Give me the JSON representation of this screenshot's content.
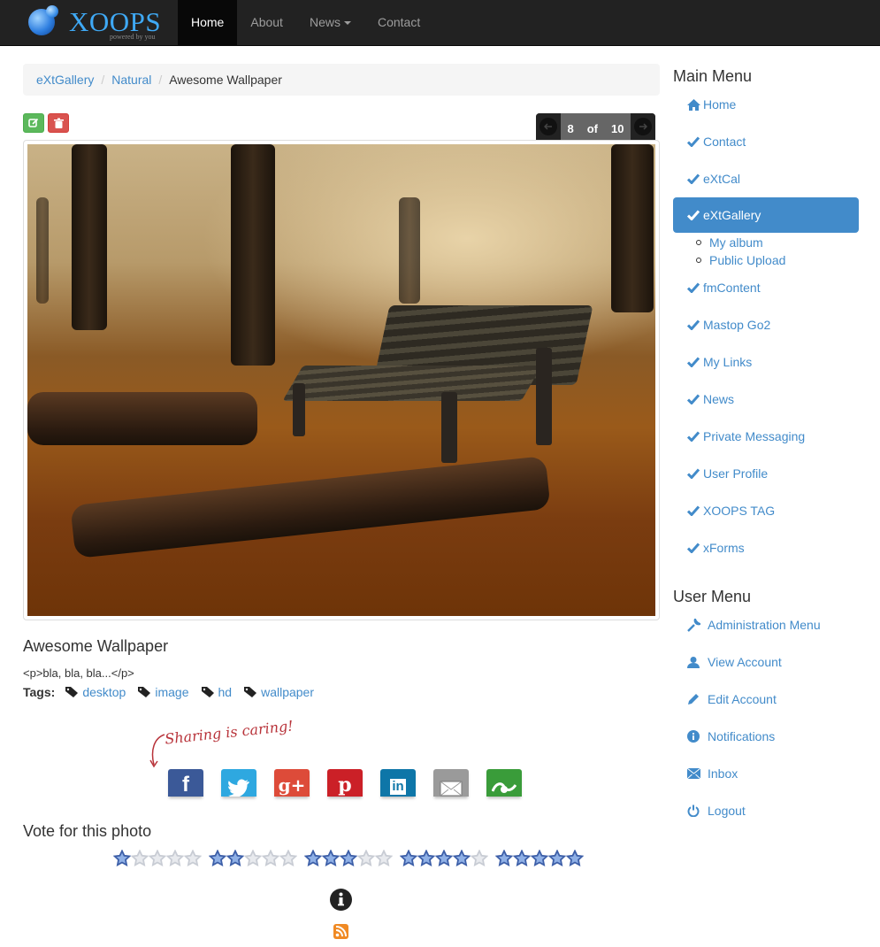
{
  "navbar": {
    "brand": "XOOPS",
    "brand_tagline": "powered by you",
    "items": [
      {
        "label": "Home",
        "active": true
      },
      {
        "label": "About",
        "active": false
      },
      {
        "label": "News",
        "active": false,
        "dropdown": true
      },
      {
        "label": "Contact",
        "active": false
      }
    ]
  },
  "breadcrumb": [
    {
      "label": "eXtGallery",
      "link": true
    },
    {
      "label": "Natural",
      "link": true
    },
    {
      "label": "Awesome Wallpaper",
      "link": false
    }
  ],
  "actions": {
    "edit_icon": "edit-icon",
    "delete_icon": "trash-icon"
  },
  "pager": {
    "current": "8",
    "of_label": "of",
    "total": "10",
    "prev_icon": "arrow-left-icon",
    "next_icon": "arrow-right-icon"
  },
  "photo": {
    "title": "Awesome Wallpaper",
    "description": "<p>bla, bla, bla...</p>",
    "alt": "Autumn park bench with fallen leaves"
  },
  "tags": {
    "label": "Tags:",
    "items": [
      "desktop",
      "image",
      "hd",
      "wallpaper"
    ]
  },
  "share": {
    "note": "Sharing is caring!",
    "buttons": [
      {
        "name": "facebook",
        "glyph": "f",
        "color": "#3b5998"
      },
      {
        "name": "twitter",
        "glyph": "t",
        "color": "#2ea8e0"
      },
      {
        "name": "google-plus",
        "glyph": "g+",
        "color": "#dd4b39"
      },
      {
        "name": "pinterest",
        "glyph": "p",
        "color": "#cb2027"
      },
      {
        "name": "linkedin",
        "glyph": "in",
        "color": "#0e76a8"
      },
      {
        "name": "email",
        "glyph": "✉",
        "color": "#9a9a9a"
      },
      {
        "name": "sharethis",
        "glyph": "share",
        "color": "#3a9c3a"
      }
    ]
  },
  "vote": {
    "title": "Vote for this photo",
    "options": [
      1,
      2,
      3,
      4,
      5
    ],
    "max": 5
  },
  "sidebar": {
    "main_menu_title": "Main Menu",
    "main_menu": [
      {
        "label": "Home",
        "icon": "home-icon"
      },
      {
        "label": "Contact",
        "icon": "check-icon"
      },
      {
        "label": "eXtCal",
        "icon": "check-icon"
      },
      {
        "label": "eXtGallery",
        "icon": "check-icon",
        "active": true,
        "children": [
          "My album",
          "Public Upload"
        ]
      },
      {
        "label": "fmContent",
        "icon": "check-icon"
      },
      {
        "label": "Mastop Go2",
        "icon": "check-icon"
      },
      {
        "label": "My Links",
        "icon": "check-icon"
      },
      {
        "label": "News",
        "icon": "check-icon"
      },
      {
        "label": "Private Messaging",
        "icon": "check-icon"
      },
      {
        "label": "User Profile",
        "icon": "check-icon"
      },
      {
        "label": "XOOPS TAG",
        "icon": "check-icon"
      },
      {
        "label": "xForms",
        "icon": "check-icon"
      }
    ],
    "user_menu_title": "User Menu",
    "user_menu": [
      {
        "label": "Administration Menu",
        "icon": "wrench-icon"
      },
      {
        "label": "View Account",
        "icon": "user-icon"
      },
      {
        "label": "Edit Account",
        "icon": "pencil-icon"
      },
      {
        "label": "Notifications",
        "icon": "info-icon"
      },
      {
        "label": "Inbox",
        "icon": "envelope-icon"
      },
      {
        "label": "Logout",
        "icon": "power-icon"
      }
    ]
  },
  "colors": {
    "link": "#428bca",
    "active_menu": "#428bca",
    "navbar": "#222222",
    "star_filled": "#3d5fa8",
    "star_empty": "#c8ccd4"
  }
}
